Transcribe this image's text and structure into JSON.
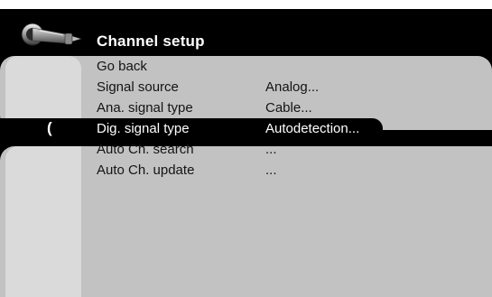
{
  "header": {
    "title": "Channel setup",
    "icon": "antenna-connector-icon"
  },
  "cursor_glyph": "(",
  "menu": {
    "items": [
      {
        "label": "Go back",
        "value": ""
      },
      {
        "label": "Signal source",
        "value": "Analog..."
      },
      {
        "label": "Ana. signal type",
        "value": "Cable..."
      },
      {
        "label": "Dig. signal type",
        "value": "Autodetection..."
      },
      {
        "label": "Auto Ch. search",
        "value": "..."
      },
      {
        "label": "Auto Ch. update",
        "value": "..."
      }
    ],
    "selected_index": 3
  },
  "colors": {
    "background": "#000000",
    "panel": "#c2c2c2",
    "panel_light": "#dadada",
    "text": "#141414",
    "highlight_text": "#ffffff"
  }
}
